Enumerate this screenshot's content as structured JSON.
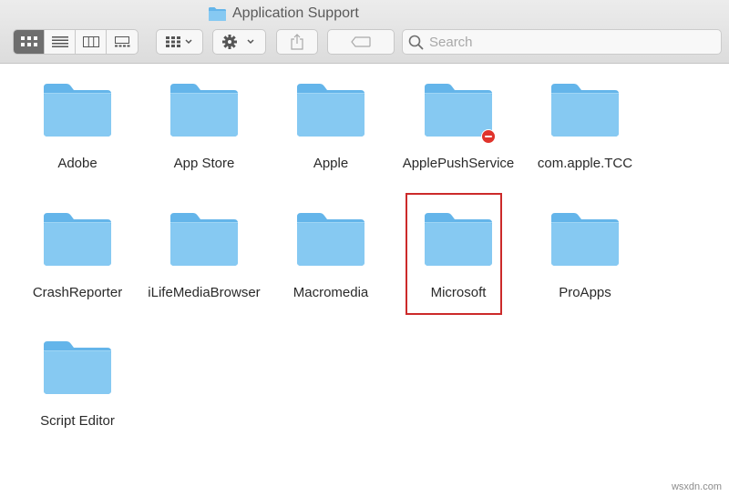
{
  "window": {
    "title": "Application Support"
  },
  "toolbar": {
    "view_buttons": [
      {
        "icon": "icon-view-icon",
        "active": true
      },
      {
        "icon": "list-view-icon",
        "active": false
      },
      {
        "icon": "column-view-icon",
        "active": false
      },
      {
        "icon": "gallery-view-icon",
        "active": false
      }
    ],
    "group_icon": "group-by-icon",
    "action_icon": "gear-icon",
    "share_icon": "share-icon",
    "tag_icon": "tag-icon",
    "search": {
      "placeholder": "Search",
      "value": ""
    }
  },
  "folders": [
    {
      "label": "Adobe"
    },
    {
      "label": "App Store"
    },
    {
      "label": "Apple"
    },
    {
      "label": "ApplePushService",
      "badge": "no-access"
    },
    {
      "label": "com.apple.TCC"
    },
    {
      "label": "CrashReporter"
    },
    {
      "label": "iLifeMediaBrowser"
    },
    {
      "label": "Macromedia"
    },
    {
      "label": "Microsoft",
      "highlighted": true
    },
    {
      "label": "ProApps"
    },
    {
      "label": "Script Editor"
    }
  ],
  "colors": {
    "folder": "#7cc4f0",
    "highlight": "#cc2a2a",
    "badge": "#e0332b"
  },
  "watermark": "wsxdn.com"
}
